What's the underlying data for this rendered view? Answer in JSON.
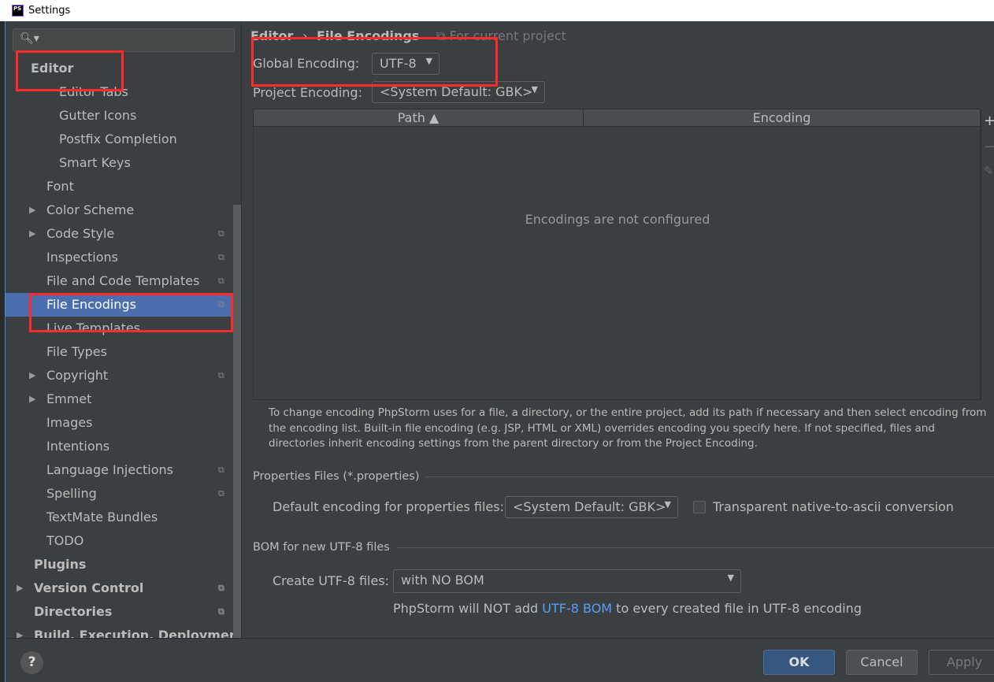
{
  "window": {
    "title": "Settings",
    "logo": "PS"
  },
  "sidebar": {
    "search_icon": "search-icon",
    "items": [
      {
        "label": "Editor",
        "level": 0,
        "bold": true
      },
      {
        "label": "Editor Tabs",
        "level": 2
      },
      {
        "label": "Gutter Icons",
        "level": 2
      },
      {
        "label": "Postfix Completion",
        "level": 2
      },
      {
        "label": "Smart Keys",
        "level": 2
      },
      {
        "label": "Font",
        "level": 1
      },
      {
        "label": "Color Scheme",
        "level": 1,
        "expandable": true
      },
      {
        "label": "Code Style",
        "level": 1,
        "expandable": true,
        "project": true
      },
      {
        "label": "Inspections",
        "level": 1,
        "project": true
      },
      {
        "label": "File and Code Templates",
        "level": 1,
        "project": true
      },
      {
        "label": "File Encodings",
        "level": 1,
        "project": true,
        "selected": true
      },
      {
        "label": "Live Templates",
        "level": 1
      },
      {
        "label": "File Types",
        "level": 1
      },
      {
        "label": "Copyright",
        "level": 1,
        "expandable": true,
        "project": true
      },
      {
        "label": "Emmet",
        "level": 1,
        "expandable": true
      },
      {
        "label": "Images",
        "level": 1
      },
      {
        "label": "Intentions",
        "level": 1
      },
      {
        "label": "Language Injections",
        "level": 1,
        "project": true
      },
      {
        "label": "Spelling",
        "level": 1,
        "project": true
      },
      {
        "label": "TextMate Bundles",
        "level": 1
      },
      {
        "label": "TODO",
        "level": 1
      },
      {
        "label": "Plugins",
        "level": 0,
        "bold": true
      },
      {
        "label": "Version Control",
        "level": 0,
        "bold": true,
        "expandable": true,
        "project": true
      },
      {
        "label": "Directories",
        "level": 0,
        "bold": true,
        "project": true
      },
      {
        "label": "Build, Execution, Deployment",
        "level": 0,
        "bold": true,
        "expandable": true
      }
    ]
  },
  "main": {
    "breadcrumb": {
      "parent": "Editor",
      "sep": "›",
      "current": "File Encodings",
      "scope": "For current project"
    },
    "global_encoding": {
      "label": "Global Encoding:",
      "value": "UTF-8"
    },
    "project_encoding": {
      "label": "Project Encoding:",
      "value": "<System Default: GBK>"
    },
    "table": {
      "columns": [
        "Path ▲",
        "Encoding"
      ],
      "empty_text": "Encodings are not configured",
      "add": "+",
      "remove": "−",
      "edit": "✎"
    },
    "note": "To change encoding PhpStorm uses for a file, a directory, or the entire project, add its path if necessary and then select encoding from the encoding list. Built-in file encoding (e.g. JSP, HTML or XML) overrides encoding you specify here. If not specified, files and directories inherit encoding settings from the parent directory or from the Project Encoding.",
    "properties": {
      "section": "Properties Files (*.properties)",
      "label": "Default encoding for properties files:",
      "value": "<System Default: GBK>",
      "checkbox_label": "Transparent native-to-ascii conversion",
      "checked": false
    },
    "bom": {
      "section": "BOM for new UTF-8 files",
      "label": "Create UTF-8 files:",
      "value": "with NO BOM",
      "hint_pre": "PhpStorm will NOT add ",
      "hint_link": "UTF-8 BOM",
      "hint_post": " to every created file in UTF-8 encoding"
    }
  },
  "footer": {
    "help": "?",
    "ok": "OK",
    "cancel": "Cancel",
    "apply": "Apply"
  },
  "colors": {
    "selection": "#4b6eaf",
    "annotation": "#ff2a2a",
    "link": "#589df6"
  }
}
